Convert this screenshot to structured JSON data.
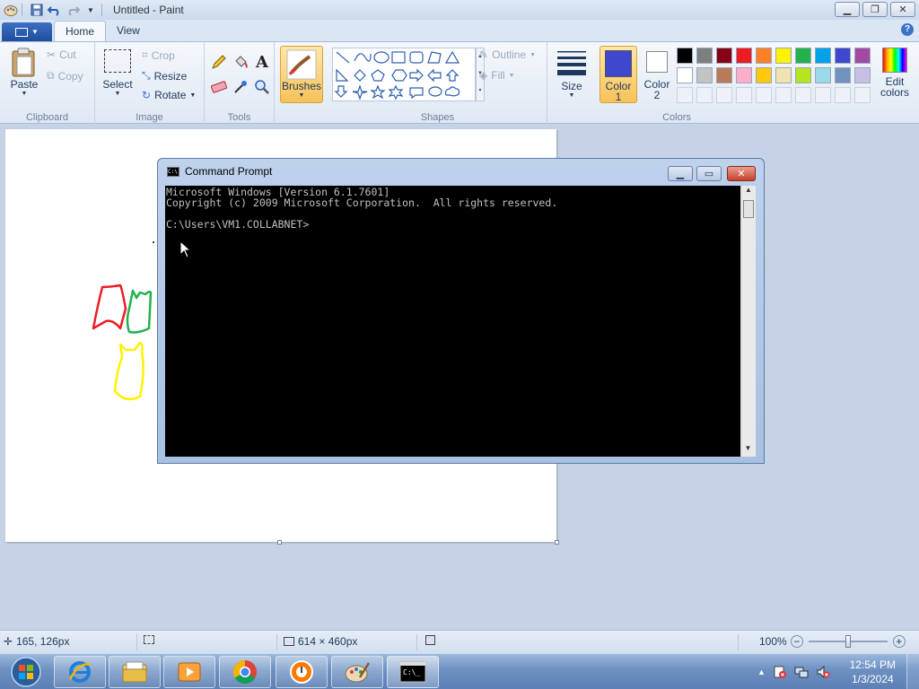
{
  "window": {
    "title": "Untitled - Paint",
    "controls": [
      "minimize",
      "maximize",
      "close"
    ]
  },
  "ribbon": {
    "file_label": "▼",
    "tabs": [
      {
        "label": "Home",
        "active": true
      },
      {
        "label": "View",
        "active": false
      }
    ],
    "clipboard": {
      "group_label": "Clipboard",
      "paste": "Paste",
      "cut": "Cut",
      "copy": "Copy"
    },
    "image": {
      "group_label": "Image",
      "select": "Select",
      "crop": "Crop",
      "resize": "Resize",
      "rotate": "Rotate"
    },
    "tools": {
      "group_label": "Tools",
      "items": [
        "pencil-icon",
        "fill-bucket-icon",
        "text-icon",
        "eraser-icon",
        "color-picker-icon",
        "magnifier-icon"
      ]
    },
    "brushes": {
      "label": "Brushes"
    },
    "shapes": {
      "group_label": "Shapes",
      "outline": "Outline",
      "fill": "Fill"
    },
    "size": {
      "label": "Size"
    },
    "colors": {
      "group_label": "Colors",
      "color1_label": "Color",
      "color1_num": "1",
      "color2_label": "Color",
      "color2_num": "2",
      "color1": "#3f48cc",
      "color2": "#ffffff",
      "edit_colors_1": "Edit",
      "edit_colors_2": "colors",
      "palette_row1": [
        "#000000",
        "#7f7f7f",
        "#880015",
        "#ed1c24",
        "#ff7f27",
        "#fff200",
        "#22b14c",
        "#00a2e8",
        "#3f48cc",
        "#a349a4"
      ],
      "palette_row2": [
        "#ffffff",
        "#c3c3c3",
        "#b97a57",
        "#ffaec9",
        "#ffc90e",
        "#efe4b0",
        "#b5e61d",
        "#99d9ea",
        "#7092be",
        "#c8bfe7"
      ]
    }
  },
  "cmd": {
    "title": "Command Prompt",
    "icon_text": "C:\\",
    "lines": [
      "Microsoft Windows [Version 6.1.7601]",
      "Copyright (c) 2009 Microsoft Corporation.  All rights reserved.",
      "",
      "C:\\Users\\VM1.COLLABNET>"
    ]
  },
  "statusbar": {
    "cursor_pos": "165, 126px",
    "selection_size": "",
    "canvas_size": "614 × 460px",
    "zoom": "100%",
    "zoom_level": 0.5
  },
  "taskbar": {
    "apps": [
      "internet-explorer-icon",
      "windows-explorer-icon",
      "media-player-icon",
      "chrome-icon",
      "avast-icon",
      "paint-icon",
      "cmd-icon"
    ],
    "time": "12:54 PM",
    "date": "1/3/2024"
  }
}
